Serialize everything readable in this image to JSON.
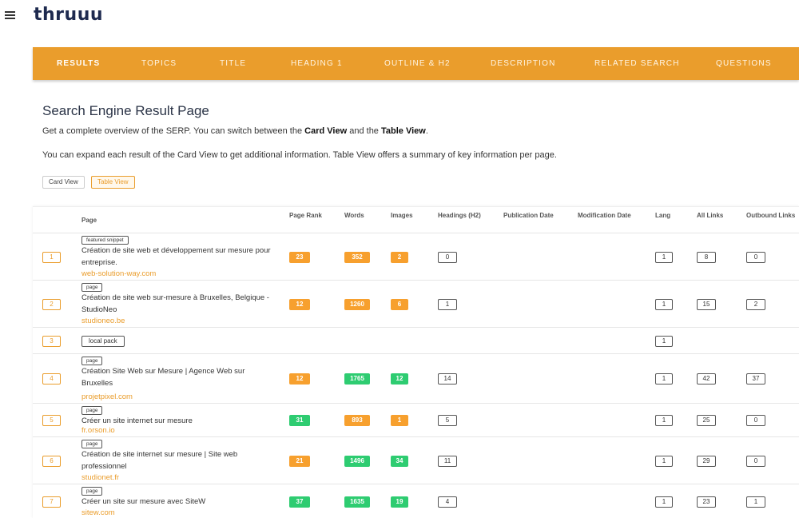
{
  "app": {
    "logo": "thruuu",
    "menu_icon": "hamburger-icon"
  },
  "nav": {
    "tabs": [
      {
        "label": "RESULTS",
        "active": true
      },
      {
        "label": "TOPICS"
      },
      {
        "label": "TITLE"
      },
      {
        "label": "HEADING 1"
      },
      {
        "label": "OUTLINE & H2"
      },
      {
        "label": "DESCRIPTION"
      },
      {
        "label": "RELATED SEARCH"
      },
      {
        "label": "QUESTIONS"
      }
    ]
  },
  "page": {
    "title": "Search Engine Result Page",
    "desc1_pre": "Get a complete overview of the SERP. You can switch between the ",
    "desc1_card": "Card View",
    "desc1_mid": " and the ",
    "desc1_table": "Table View",
    "desc1_end": ".",
    "desc2": "You can expand each result of the Card View to get additional information. Table View offers a summary of key information per page.",
    "card_view_label": "Card View",
    "table_view_label": "Table View"
  },
  "table": {
    "headers": {
      "page": "Page",
      "page_rank": "Page Rank",
      "words": "Words",
      "images": "Images",
      "headings": "Headings (H2)",
      "pub_date": "Publication Date",
      "mod_date": "Modification Date",
      "lang": "Lang",
      "all_links": "All Links",
      "outbound": "Outbound Links"
    },
    "rows": [
      {
        "rank": "1",
        "type": "featured snippet",
        "title": "Création de site web et développement sur mesure pour entreprise.",
        "url": "web-solution-way.com",
        "page_rank": "23",
        "page_rank_color": "orange",
        "words": "352",
        "words_color": "orange",
        "images": "2",
        "images_color": "orange",
        "headings": "0",
        "lang": "1",
        "all_links": "8",
        "outbound": "0"
      },
      {
        "rank": "2",
        "type": "page",
        "title": "Création de site web sur-mesure à Bruxelles, Belgique - StudioNeo",
        "url": "studioneo.be",
        "page_rank": "12",
        "page_rank_color": "orange",
        "words": "1260",
        "words_color": "orange",
        "images": "6",
        "images_color": "orange",
        "headings": "1",
        "lang": "1",
        "all_links": "15",
        "outbound": "2"
      },
      {
        "rank": "3",
        "type": "local pack",
        "lang": "1"
      },
      {
        "rank": "4",
        "type": "page",
        "title": "Création Site Web sur Mesure | Agence Web sur Bruxelles",
        "url": "projetpixel.com",
        "page_rank": "12",
        "page_rank_color": "orange",
        "words": "1765",
        "words_color": "green",
        "images": "12",
        "images_color": "green",
        "headings": "14",
        "lang": "1",
        "all_links": "42",
        "outbound": "37"
      },
      {
        "rank": "5",
        "type": "page",
        "title": "Créer un site internet sur mesure",
        "url": "fr.orson.io",
        "page_rank": "31",
        "page_rank_color": "green",
        "words": "893",
        "words_color": "orange",
        "images": "1",
        "images_color": "orange",
        "headings": "5",
        "lang": "1",
        "all_links": "25",
        "outbound": "0"
      },
      {
        "rank": "6",
        "type": "page",
        "title": "Création de site internet sur mesure | Site web professionnel",
        "url": "studionet.fr",
        "page_rank": "21",
        "page_rank_color": "orange",
        "words": "1496",
        "words_color": "green",
        "images": "34",
        "images_color": "green",
        "headings": "11",
        "lang": "1",
        "all_links": "29",
        "outbound": "0"
      },
      {
        "rank": "7",
        "type": "page",
        "title": "Créer un site sur mesure avec SiteW",
        "url": "sitew.com",
        "page_rank": "37",
        "page_rank_color": "green",
        "words": "1635",
        "words_color": "green",
        "images": "19",
        "images_color": "green",
        "headings": "4",
        "lang": "1",
        "all_links": "23",
        "outbound": "1"
      }
    ]
  }
}
